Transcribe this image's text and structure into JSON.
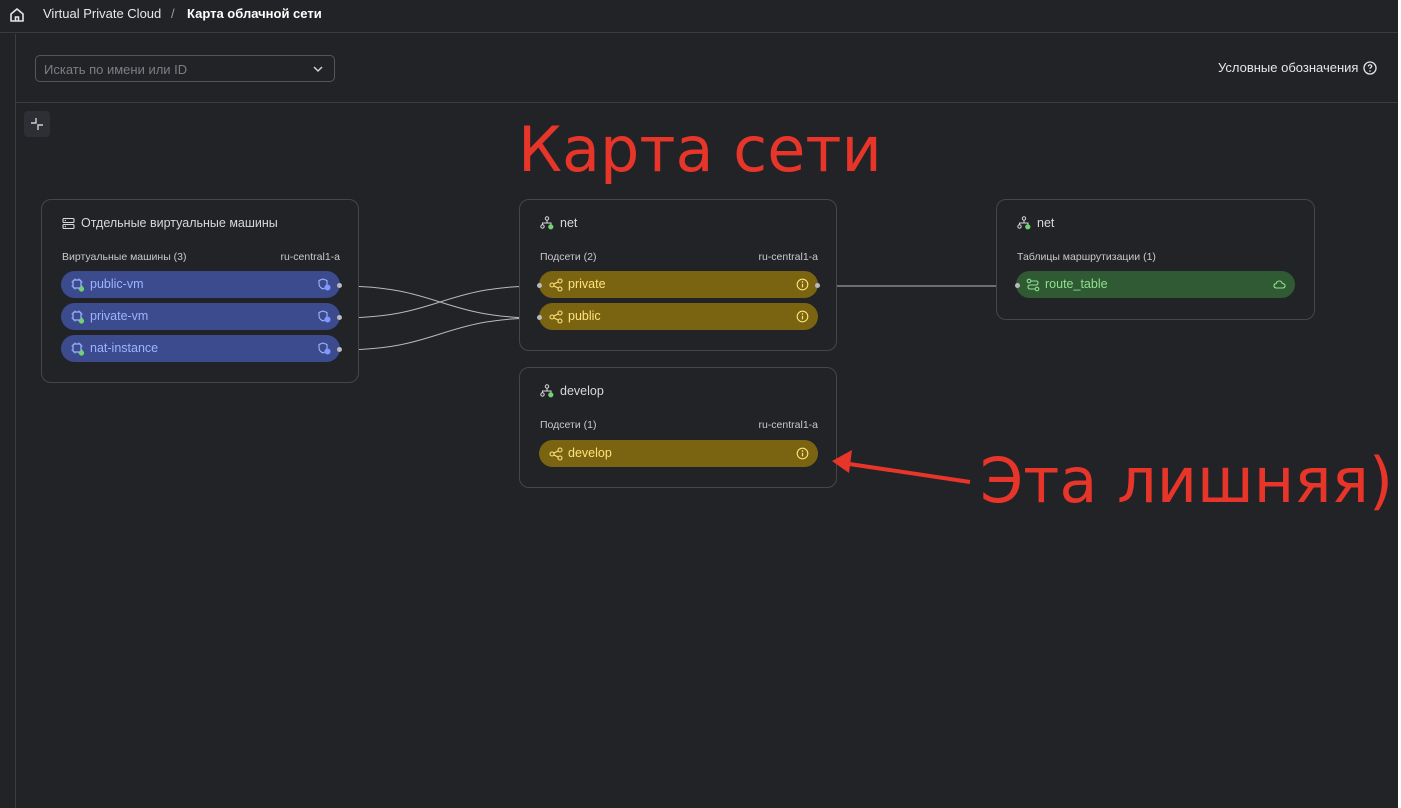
{
  "breadcrumb": {
    "root": "Virtual Private Cloud",
    "separator": "/",
    "current": "Карта облачной сети"
  },
  "search": {
    "placeholder": "Искать по имени или ID"
  },
  "legend_link": "Условные обозначения",
  "cards": {
    "vms": {
      "title": "Отдельные виртуальные машины",
      "subtitle": "Виртуальные машины (3)",
      "zone": "ru-central1-a",
      "items": [
        "public-vm",
        "private-vm",
        "nat-instance"
      ]
    },
    "net": {
      "title": "net",
      "subtitle": "Подсети (2)",
      "zone": "ru-central1-a",
      "items": [
        "private",
        "public"
      ]
    },
    "develop": {
      "title": "develop",
      "subtitle": "Подсети (1)",
      "zone": "ru-central1-a",
      "items": [
        "develop"
      ]
    },
    "routes": {
      "title": "net",
      "subtitle": "Таблицы маршрутизации (1)",
      "items": [
        "route_table"
      ]
    }
  },
  "annotations": {
    "title": "Карта сети",
    "note": "Эта лишняя)"
  },
  "colors": {
    "background": "#222327",
    "vm_pill": "#3b4b8e",
    "subnet_pill": "#7a6412",
    "route_pill": "#2f5a34",
    "annotation": "#e8352a"
  }
}
